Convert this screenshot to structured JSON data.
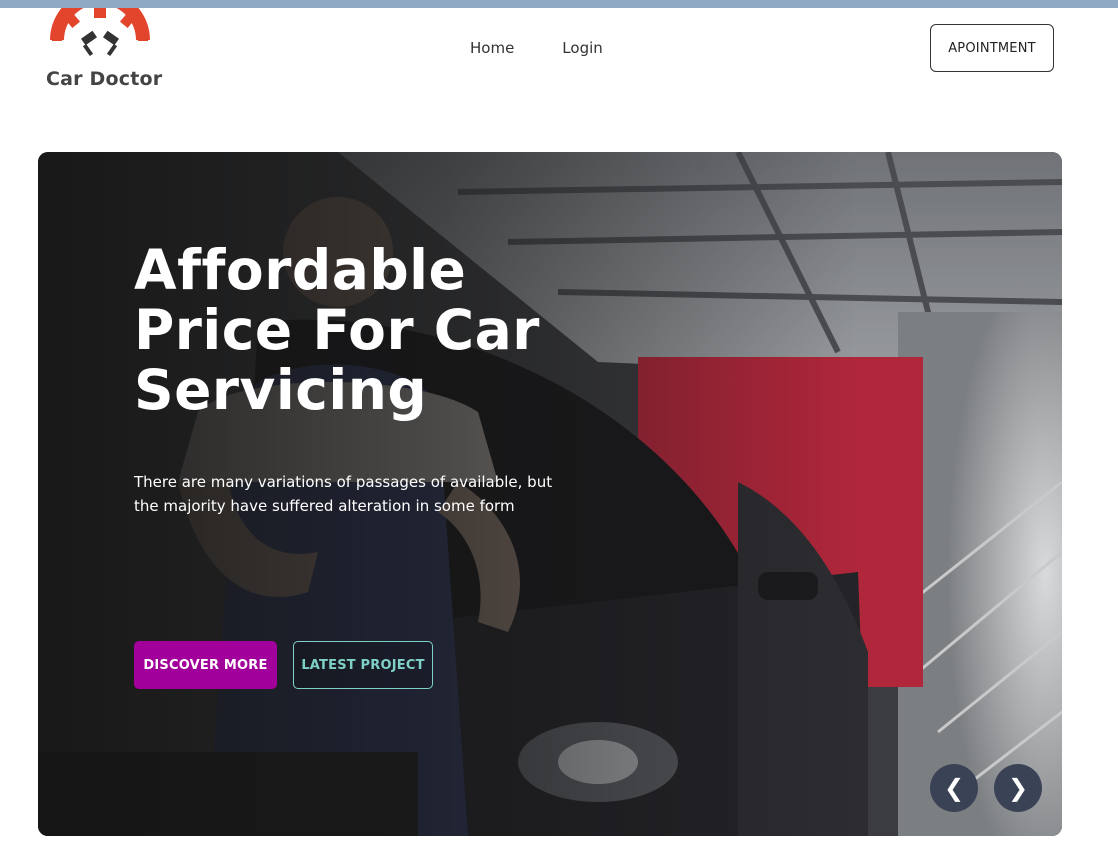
{
  "brand": {
    "name": "Car Doctor",
    "logo_icon": "gear-pistons-logo",
    "accent_color": "#e2452c"
  },
  "nav": {
    "items": [
      {
        "label": "Home"
      },
      {
        "label": "Login"
      }
    ]
  },
  "header": {
    "appointment_label": "APOINTMENT"
  },
  "hero": {
    "headline": "Affordable Price For Car Servicing",
    "description": "There are many variations of passages of available, but the majority have suffered alteration in some form",
    "primary_button": "DISCOVER MORE",
    "secondary_button": "LATEST PROJECT",
    "prev_arrow": "❮",
    "next_arrow": "❯",
    "primary_color": "#a2009b",
    "outline_color": "#7fd1c8"
  }
}
